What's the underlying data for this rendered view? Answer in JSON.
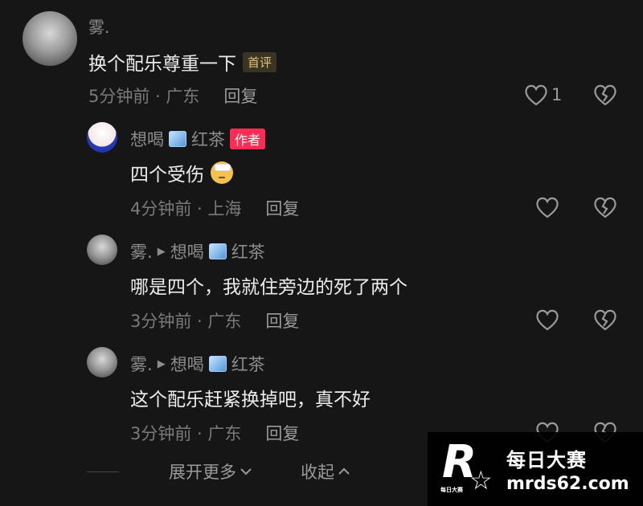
{
  "comments": [
    {
      "author": "雾.",
      "text": "换个配乐尊重一下",
      "badge": "首评",
      "time": "5分钟前 · 广东",
      "reply_label": "回复",
      "likes": "1"
    }
  ],
  "replies": [
    {
      "author": "想喝",
      "author_suffix": "红茶",
      "badge": "作者",
      "text": "四个受伤",
      "time": "4分钟前 · 上海",
      "reply_label": "回复"
    },
    {
      "author": "雾.",
      "reply_to": "想喝",
      "reply_to_suffix": "红茶",
      "text": "哪是四个，我就住旁边的死了两个",
      "time": "3分钟前 · 广东",
      "reply_label": "回复"
    },
    {
      "author": "雾.",
      "reply_to": "想喝",
      "reply_to_suffix": "红茶",
      "text": "这个配乐赶紧换掉吧，真不好",
      "time": "3分钟前 · 广东",
      "reply_label": "回复"
    }
  ],
  "footer": {
    "expand_label": "展开更多",
    "collapse_label": "收起"
  },
  "watermark": {
    "logo_letter": "R",
    "logo_small": "每日大赛",
    "title": "每日大赛",
    "url": "mrds62.com"
  },
  "colors": {
    "background": "#161616",
    "author_badge": "#fe2c55",
    "first_badge_text": "#e6c37a"
  },
  "icons": {
    "like": "heart-outline-icon",
    "dislike": "broken-heart-icon",
    "tea_emoji": "ice-cube-icon",
    "reply_arrow": "right-triangle-icon",
    "emoji": "injured-face-icon"
  }
}
